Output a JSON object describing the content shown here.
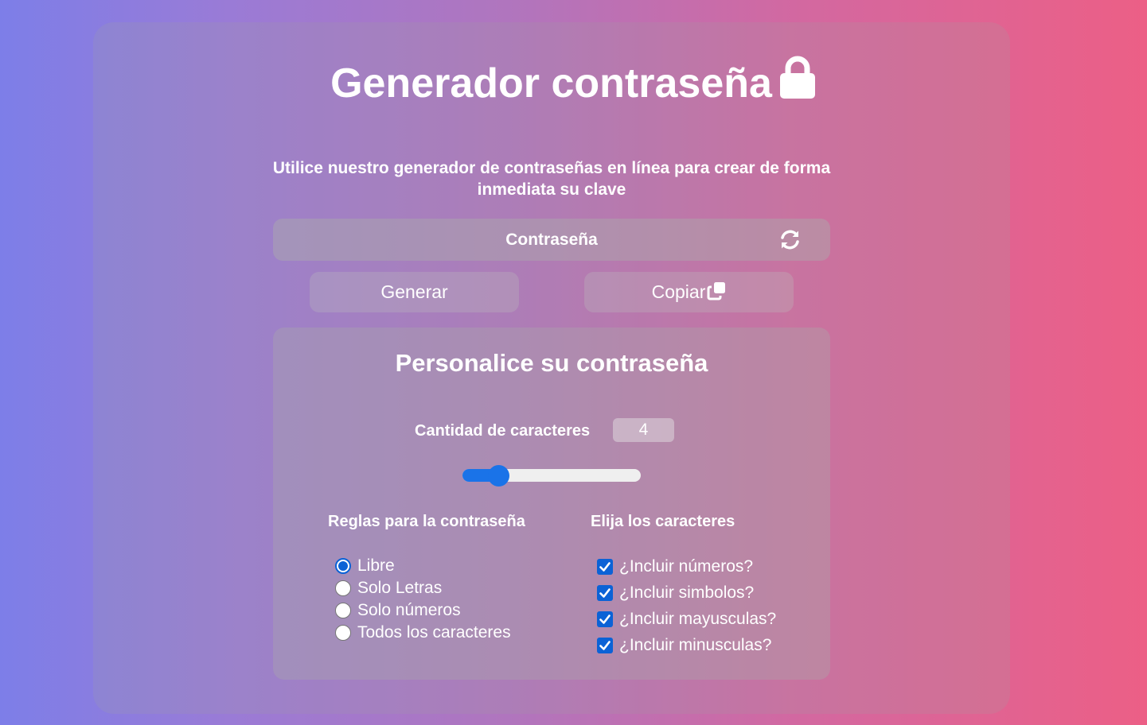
{
  "header": {
    "title": "Generador contraseña",
    "title_icon": "lock-icon",
    "subtitle": "Utilice nuestro generador de contraseñas en línea para crear de forma inmediata su clave"
  },
  "password": {
    "display_text": "Contraseña",
    "refresh_icon": "refresh-icon"
  },
  "actions": {
    "generate_label": "Generar",
    "copy_label": "Copiar",
    "copy_icon": "copy-icon"
  },
  "customize": {
    "title": "Personalice su contraseña",
    "length_label": "Cantidad de caracteres",
    "length_value": "4",
    "slider_fraction": 0.2,
    "rules_title": "Reglas para la contraseña",
    "rules": [
      {
        "label": "Libre",
        "checked": true
      },
      {
        "label": "Solo Letras",
        "checked": false
      },
      {
        "label": "Solo números",
        "checked": false
      },
      {
        "label": "Todos los caracteres",
        "checked": false
      }
    ],
    "chars_title": "Elija los caracteres",
    "options": [
      {
        "label": "¿Incluir números?",
        "checked": true
      },
      {
        "label": "¿Incluir simbolos?",
        "checked": true
      },
      {
        "label": "¿Incluir mayusculas?",
        "checked": true
      },
      {
        "label": "¿Incluir minusculas?",
        "checked": true
      }
    ]
  },
  "colors": {
    "gradient_start": "#7d7ee8",
    "gradient_end": "#ec5f86",
    "accent": "#0b62d6",
    "slider_accent": "#1a73e8"
  }
}
